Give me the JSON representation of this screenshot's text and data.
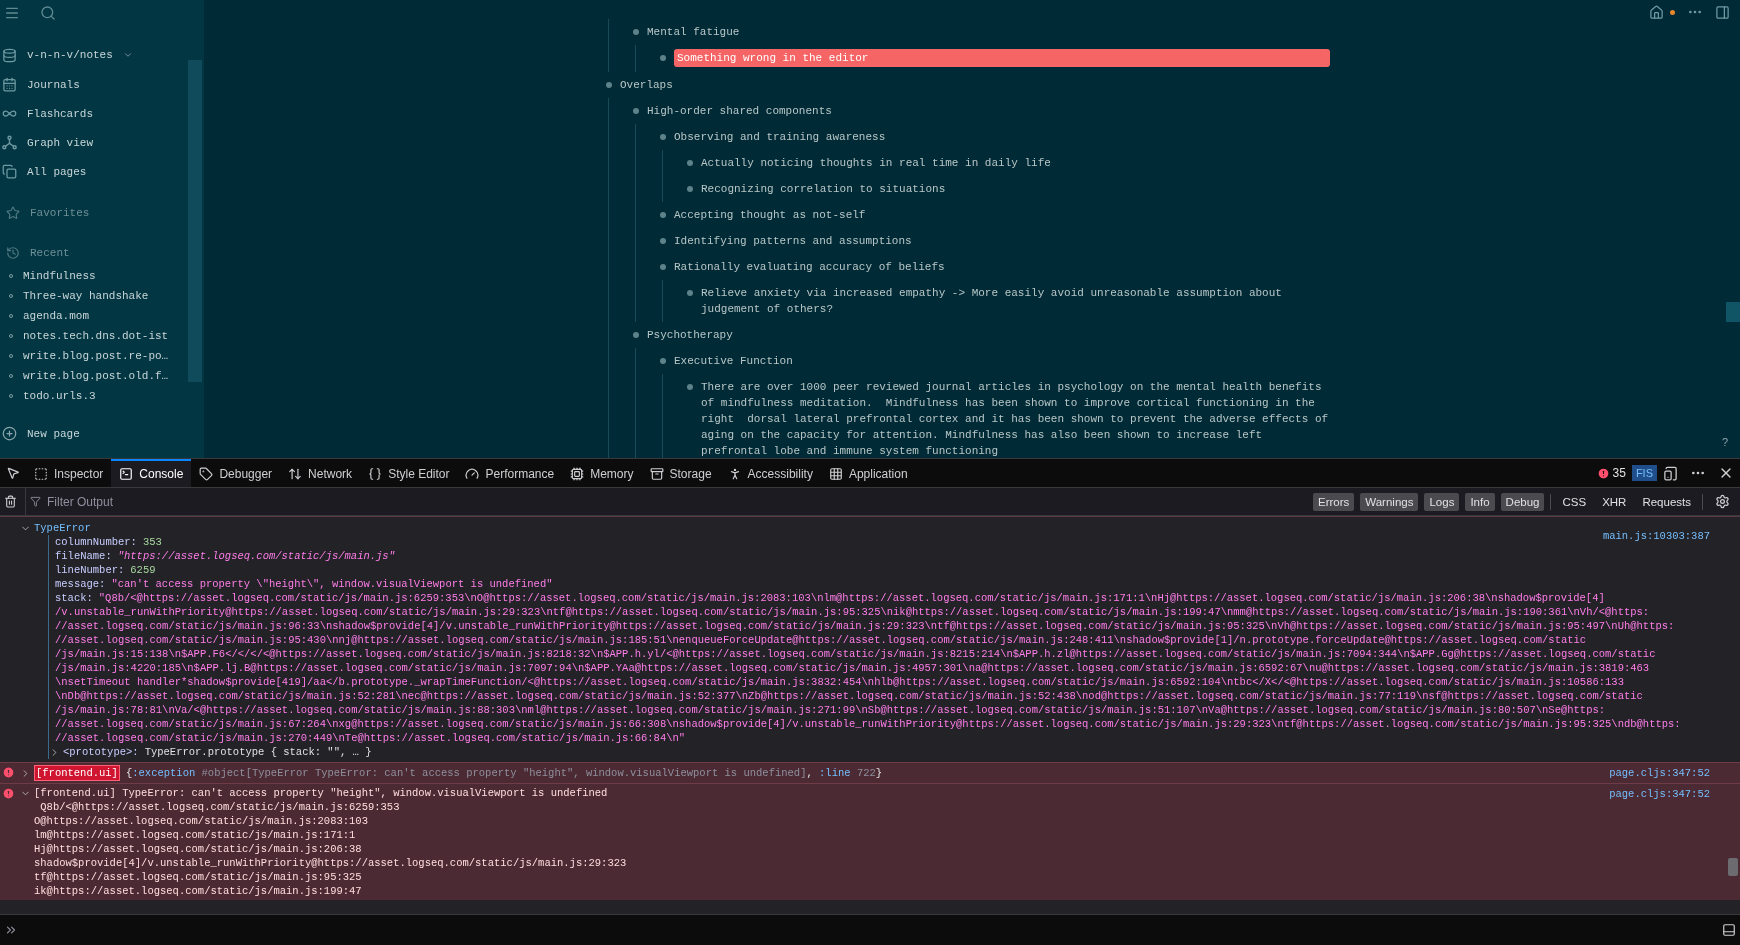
{
  "app": {
    "sidebar": {
      "repo": "v-n-n-v/notes",
      "nav": [
        {
          "label": "Journals",
          "kind": "journals"
        },
        {
          "label": "Flashcards",
          "kind": "flashcards"
        },
        {
          "label": "Graph view",
          "kind": "graph"
        },
        {
          "label": "All pages",
          "kind": "pages"
        }
      ],
      "favorites": "Favorites",
      "recent_title": "Recent",
      "recent": [
        "Mindfulness",
        "Three-way handshake",
        "agenda.mom",
        "notes.tech.dns.dot-ist",
        "write.blog.post.re-po…",
        "write.blog.post.old.f…",
        "todo.urls.3"
      ],
      "new_page": "New page"
    },
    "editor": {
      "continued": [
        {
          "kind": "text",
          "text": "Mental fatigue",
          "children": [
            {
              "kind": "error",
              "text": "Something wrong in the editor"
            }
          ]
        }
      ],
      "blocks": [
        {
          "kind": "text",
          "text": "Overlaps",
          "children": [
            {
              "kind": "text",
              "text": "High-order shared components",
              "children": [
                {
                  "kind": "text",
                  "text": "Observing and training awareness",
                  "children": [
                    {
                      "kind": "text",
                      "text": "Actually noticing thoughts in real time in daily life"
                    },
                    {
                      "kind": "text",
                      "text": "Recognizing correlation to situations"
                    }
                  ]
                },
                {
                  "kind": "text",
                  "text": "Accepting thought as not-self"
                },
                {
                  "kind": "text",
                  "text": "Identifying patterns and assumptions"
                },
                {
                  "kind": "text",
                  "text": "Rationally evaluating accuracy of beliefs",
                  "children": [
                    {
                      "kind": "text",
                      "text": "Relieve anxiety via increased empathy -> More easily avoid unreasonable assumption about judgement of others?"
                    }
                  ]
                }
              ]
            },
            {
              "kind": "text",
              "text": "Psychotherapy",
              "children": [
                {
                  "kind": "text",
                  "text": "Executive Function",
                  "children": [
                    {
                      "kind": "text",
                      "text": "There are over 1000 peer reviewed journal articles in psychology on the mental health benefits of mindfulness meditation.  Mindfulness has been shown to improve cortical functioning in the right  dorsal lateral prefrontal cortex and it has been shown to prevent the adverse effects of aging on the capacity for attention. Mindfulness has also been shown to increase left prefrontal lobe and immune system functioning"
                    }
                  ]
                }
              ]
            }
          ]
        }
      ]
    },
    "help": "?"
  },
  "devtools": {
    "tabs": [
      {
        "label": "Inspector",
        "kind": "inspector",
        "selected": false
      },
      {
        "label": "Console",
        "kind": "console",
        "selected": true
      },
      {
        "label": "Debugger",
        "kind": "debugger",
        "selected": false
      },
      {
        "label": "Network",
        "kind": "network",
        "selected": false
      },
      {
        "label": "Style Editor",
        "kind": "style",
        "selected": false
      },
      {
        "label": "Performance",
        "kind": "performance",
        "selected": false
      },
      {
        "label": "Memory",
        "kind": "memory",
        "selected": false
      },
      {
        "label": "Storage",
        "kind": "storage",
        "selected": false
      },
      {
        "label": "Accessibility",
        "kind": "accessibility",
        "selected": false
      },
      {
        "label": "Application",
        "kind": "application",
        "selected": false
      }
    ],
    "error_count": "35",
    "frame": "FIS",
    "filter": {
      "placeholder": "Filter Output"
    },
    "levels": [
      {
        "label": "Errors",
        "on": true
      },
      {
        "label": "Warnings",
        "on": true
      },
      {
        "label": "Logs",
        "on": true
      },
      {
        "label": "Info",
        "on": true
      },
      {
        "label": "Debug",
        "on": true
      }
    ],
    "requests": [
      {
        "label": "CSS",
        "on": false
      },
      {
        "label": "XHR",
        "on": false
      },
      {
        "label": "Requests",
        "on": false
      }
    ],
    "messages": [
      {
        "kind": "object",
        "expanded": true,
        "title": "TypeError",
        "location": "main.js:10303:387",
        "properties": [
          {
            "key": "columnNumber:",
            "kind": "number",
            "value": "353"
          },
          {
            "key": "fileName:",
            "kind": "url",
            "value": "\"https://asset.logseq.com/static/js/main.js\""
          },
          {
            "key": "lineNumber:",
            "kind": "number",
            "value": "6259"
          },
          {
            "key": "message:",
            "kind": "string",
            "value": "\"can't access property \\\"height\\\", window.visualViewport is undefined\""
          }
        ],
        "stack_key": "stack:",
        "stack": [
          "\"Q8b/<@https://asset.logseq.com/static/js/main.js:6259:353\\nO@https://asset.logseq.com/static/js/main.js:2083:103\\nlm@https://asset.logseq.com/static/js/main.js:171:1\\nHj@https://asset.logseq.com/static/js/main.js:206:38\\nshadow$provide[4]",
          "/v.unstable_runWithPriority@https://asset.logseq.com/static/js/main.js:29:323\\ntf@https://asset.logseq.com/static/js/main.js:95:325\\nik@https://asset.logseq.com/static/js/main.js:199:47\\nmm@https://asset.logseq.com/static/js/main.js:190:361\\nVh/<@https:",
          "//asset.logseq.com/static/js/main.js:96:33\\nshadow$provide[4]/v.unstable_runWithPriority@https://asset.logseq.com/static/js/main.js:29:323\\ntf@https://asset.logseq.com/static/js/main.js:95:325\\nVh@https://asset.logseq.com/static/js/main.js:95:497\\nUh@https:",
          "//asset.logseq.com/static/js/main.js:95:430\\nnj@https://asset.logseq.com/static/js/main.js:185:51\\nenqueueForceUpdate@https://asset.logseq.com/static/js/main.js:248:411\\nshadow$provide[1]/n.prototype.forceUpdate@https://asset.logseq.com/static",
          "/js/main.js:15:138\\n$APP.F6</</</<@https://asset.logseq.com/static/js/main.js:8218:32\\n$APP.h.yl/<@https://asset.logseq.com/static/js/main.js:8215:214\\n$APP.h.zl@https://asset.logseq.com/static/js/main.js:7094:344\\n$APP.Gg@https://asset.logseq.com/static",
          "/js/main.js:4220:185\\n$APP.lj.B@https://asset.logseq.com/static/js/main.js:7097:94\\n$APP.YAa@https://asset.logseq.com/static/js/main.js:4957:301\\na@https://asset.logseq.com/static/js/main.js:6592:67\\nu@https://asset.logseq.com/static/js/main.js:3819:463",
          "\\nsetTimeout handler*shadow$provide[419]/aa</b.prototype._wrapTimeFunction/<@https://asset.logseq.com/static/js/main.js:3832:454\\nhlb@https://asset.logseq.com/static/js/main.js:6592:104\\ntbc</X</<@https://asset.logseq.com/static/js/main.js:10586:133",
          "\\nDb@https://asset.logseq.com/static/js/main.js:52:281\\nec@https://asset.logseq.com/static/js/main.js:52:377\\nZb@https://asset.logseq.com/static/js/main.js:52:438\\nod@https://asset.logseq.com/static/js/main.js:77:119\\nsf@https://asset.logseq.com/static",
          "/js/main.js:78:81\\nVa/<@https://asset.logseq.com/static/js/main.js:88:303\\nml@https://asset.logseq.com/static/js/main.js:271:99\\nSb@https://asset.logseq.com/static/js/main.js:51:107\\nVa@https://asset.logseq.com/static/js/main.js:80:507\\nSe@https:",
          "//asset.logseq.com/static/js/main.js:67:264\\nxg@https://asset.logseq.com/static/js/main.js:66:308\\nshadow$provide[4]/v.unstable_runWithPriority@https://asset.logseq.com/static/js/main.js:29:323\\ntf@https://asset.logseq.com/static/js/main.js:95:325\\ndb@https:",
          "//asset.logseq.com/static/js/main.js:270:449\\nTe@https://asset.logseq.com/static/js/main.js:66:84\\n\""
        ],
        "prototype": {
          "key": "<prototype>:",
          "value": "TypeError.prototype { stack: \"\", … }",
          "expanded": false
        }
      },
      {
        "kind": "error",
        "expanded": false,
        "tag": "[frontend.ui]",
        "location": "page.cljs:347:52",
        "parts": [
          {
            "kind": "punct",
            "text": "{"
          },
          {
            "kind": "keyword",
            "text": ":exception"
          },
          {
            "kind": "object",
            "text": " #object[TypeError TypeError: can't access property \"height\", window.visualViewport is undefined]"
          },
          {
            "kind": "punct",
            "text": ", "
          },
          {
            "kind": "keyword",
            "text": ":line"
          },
          {
            "kind": "number",
            "text": " 722"
          },
          {
            "kind": "punct",
            "text": "}"
          }
        ]
      },
      {
        "kind": "error",
        "expanded": true,
        "text": "[frontend.ui] TypeError: can't access property \"height\", window.visualViewport is undefined",
        "location": "page.cljs:347:52",
        "trace": [
          " Q8b/<@https://asset.logseq.com/static/js/main.js:6259:353",
          "O@https://asset.logseq.com/static/js/main.js:2083:103",
          "lm@https://asset.logseq.com/static/js/main.js:171:1",
          "Hj@https://asset.logseq.com/static/js/main.js:206:38",
          "shadow$provide[4]/v.unstable_runWithPriority@https://asset.logseq.com/static/js/main.js:29:323",
          "tf@https://asset.logseq.com/static/js/main.js:95:325",
          "ik@https://asset.logseq.com/static/js/main.js:199:47"
        ]
      }
    ]
  }
}
